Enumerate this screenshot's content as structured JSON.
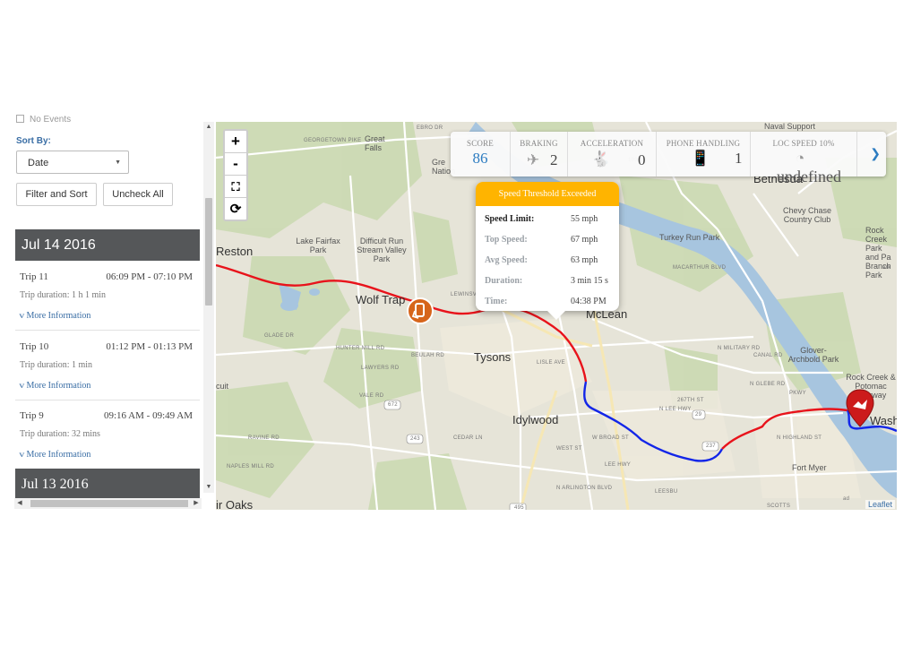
{
  "left": {
    "no_events": "No Events",
    "sort_label": "Sort By:",
    "sort_value": "Date",
    "filter_button": "Filter and Sort",
    "uncheck_button": "Uncheck All",
    "days": [
      {
        "date": "Jul 14 2016",
        "trips": [
          {
            "name": "Trip 11",
            "time": "06:09 PM - 07:10 PM",
            "duration": "Trip duration: 1 h 1 min",
            "more": "More Information"
          },
          {
            "name": "Trip 10",
            "time": "01:12 PM - 01:13 PM",
            "duration": "Trip duration: 1 min",
            "more": "More Information"
          },
          {
            "name": "Trip 9",
            "time": "09:16 AM - 09:49 AM",
            "duration": "Trip duration: 32 mins",
            "more": "More Information"
          }
        ]
      },
      {
        "date": "Jul 13 2016",
        "trips": []
      }
    ]
  },
  "map": {
    "zoom_in": "+",
    "zoom_out": "-",
    "fit_icon": "fullscreen-icon",
    "reset_icon": "refresh-icon",
    "attribution": "Leaflet",
    "labels": {
      "reston": "Reston",
      "wolf_trap": "Wolf Trap",
      "tysons": "Tysons",
      "mclean": "McLean",
      "idylwood": "Idylwood",
      "bethesda": "Bethesda",
      "great_falls": "Great Falls",
      "lake_fairfax": "Lake Fairfax Park",
      "difficult_run": "Difficult Run Stream Valley Park",
      "chevy_chase": "Chevy Chase Country Club",
      "turkey_run": "Turkey Run Park",
      "glover": "Glover-Archbold Park",
      "rock_creek": "Rock Creek & Potomac Parkway",
      "fort_myer": "Fort Myer",
      "falls_church": "ir Oaks",
      "wash": "Wash",
      "naval_support": "Naval Support",
      "rock_creek_park": "Rock Creek Park and Pa Branch Park",
      "gre": "Gre Nation",
      "georgetown_pike": "GEORGETOWN PIKE",
      "lee_hwy": "LEE HWY",
      "n_lee_hwy": "N LEE HWY",
      "n_arlington": "N ARLINGTON BLVD",
      "lewinsville": "LEWINSVILLE",
      "glade": "GLADE DR",
      "route_267": "267TH ST",
      "route_495": "495",
      "route_237": "237",
      "route_29": "29",
      "route_243": "243",
      "route_672": "672",
      "cedar": "CEDAR LN",
      "lisle": "LISLE AVE",
      "broad": "W BROAD ST",
      "west": "WEST ST",
      "leesburg": "LEESBU",
      "military": "N MILITARY RD",
      "glebe": "N GLEBE RD",
      "highland": "N HIGHLAND ST",
      "scotts": "SCOTTS",
      "beulah": "BEULAH RD",
      "hunter_mill": "HUNTER MILL RD",
      "lawyers": "LAWYERS RD",
      "vale": "VALE RD",
      "naples": "NAPLES MILL RD",
      "ravine": "RAVINE RD",
      "cuit": "cuit",
      "ad": "ad",
      "ark": "ark",
      "parkway": "PKWY",
      "canal": "CANAL RD",
      "macarthur": "MACARTHUR BLVD",
      "ebro": "EBRO DR",
      "rt_193": "193"
    }
  },
  "stats": {
    "score_label": "SCORE",
    "score_value": "86",
    "braking_label": "BRAKING",
    "braking_value": "2",
    "braking_icon": "braking-icon",
    "accel_label": "ACCELERATION",
    "accel_value": "0",
    "accel_icon": "acceleration-icon",
    "phone_label": "PHONE HANDLING",
    "phone_value": "1",
    "phone_icon": "phone-icon",
    "loc_label": "LOC SPEED 10%",
    "loc_value": "undefined",
    "loc_icon": "speedometer-icon",
    "next_icon": "chevron-right-icon"
  },
  "popup": {
    "title": "Speed Threshold Exceeded",
    "speed_limit_label": "Speed Limit:",
    "speed_limit": "55 mph",
    "top_speed_label": "Top Speed:",
    "top_speed": "67 mph",
    "avg_speed_label": "Avg Speed:",
    "avg_speed": "63 mph",
    "duration_label": "Duration:",
    "duration": "3 min 15 s",
    "time_label": "Time:",
    "time": "04:38 PM"
  },
  "colors": {
    "speeding": "#e8131b",
    "normal": "#1326e8",
    "header": "#555759",
    "accent": "#2d7cc1",
    "popup": "#ffb400",
    "phone_marker": "#d6651b",
    "end_marker": "#cc1b1b"
  }
}
